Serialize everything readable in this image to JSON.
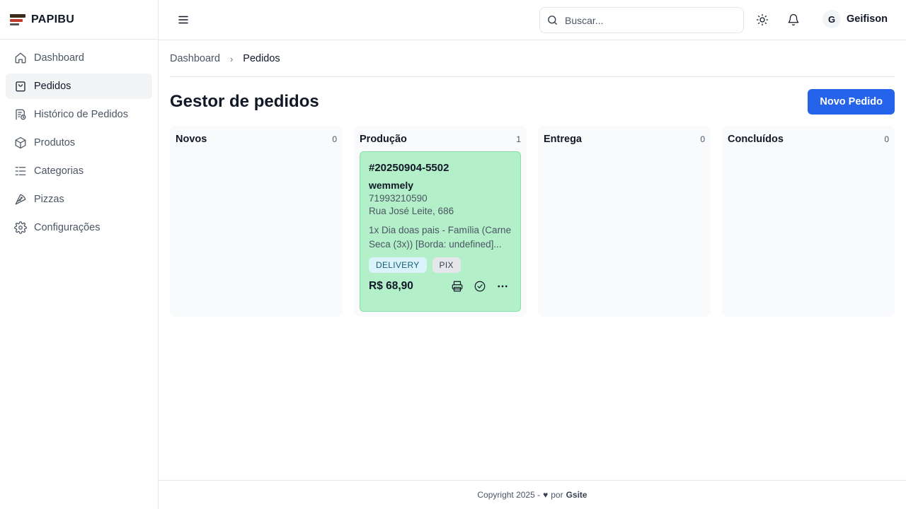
{
  "brand": {
    "name": "PAPIBU",
    "logo_icon": "papibu-logo"
  },
  "sidebar": {
    "items": [
      {
        "label": "Dashboard",
        "icon": "home-icon",
        "active": false
      },
      {
        "label": "Pedidos",
        "icon": "shopping-bag-icon",
        "active": true
      },
      {
        "label": "Histórico de Pedidos",
        "icon": "receipt-history-icon",
        "active": false
      },
      {
        "label": "Produtos",
        "icon": "box-icon",
        "active": false
      },
      {
        "label": "Categorias",
        "icon": "list-icon",
        "active": false
      },
      {
        "label": "Pizzas",
        "icon": "pizza-icon",
        "active": false
      },
      {
        "label": "Configurações",
        "icon": "gear-icon",
        "active": false
      }
    ]
  },
  "header": {
    "search_placeholder": "Buscar...",
    "user": {
      "initial": "G",
      "name": "Geifison"
    }
  },
  "breadcrumb": {
    "home": "Dashboard",
    "current": "Pedidos"
  },
  "page": {
    "title": "Gestor de pedidos",
    "new_button": "Novo Pedido"
  },
  "columns": [
    {
      "title": "Novos",
      "count": "0"
    },
    {
      "title": "Produção",
      "count": "1"
    },
    {
      "title": "Entrega",
      "count": "0"
    },
    {
      "title": "Concluídos",
      "count": "0"
    }
  ],
  "order_card": {
    "id": "#20250904-5502",
    "customer": "wemmely",
    "phone": "71993210590",
    "address": "Rua José Leite, 686",
    "items": "1x Dia doas pais - Família (Carne Seca (3x)) [Borda: undefined]...",
    "badges": [
      "DELIVERY",
      "PIX"
    ],
    "total": "R$ 68,90"
  },
  "footer": {
    "copyright": "Copyright 2025 -",
    "by": "por",
    "brand": "Gsite"
  },
  "colors": {
    "accent": "#2563eb",
    "card_bg": "#b3efc9",
    "card_border": "#86e0a8"
  }
}
